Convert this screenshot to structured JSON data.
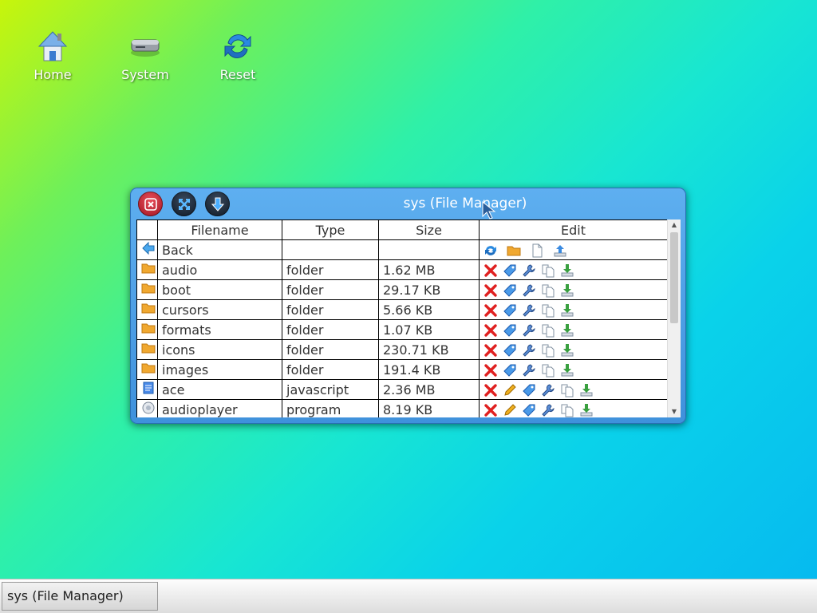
{
  "desktop": {
    "icons": [
      {
        "label": "Home",
        "icon": "home-icon"
      },
      {
        "label": "System",
        "icon": "drive-icon"
      },
      {
        "label": "Reset",
        "icon": "reset-icon"
      }
    ]
  },
  "window": {
    "title": "sys (File Manager)",
    "buttons": [
      "close-icon",
      "maximize-icon",
      "minimize-icon"
    ],
    "columns": [
      "Filename",
      "Type",
      "Size",
      "Edit"
    ],
    "back_label": "Back",
    "rows": [
      {
        "name": "audio",
        "type": "folder",
        "size": "1.62 MB"
      },
      {
        "name": "boot",
        "type": "folder",
        "size": "29.17 KB"
      },
      {
        "name": "cursors",
        "type": "folder",
        "size": "5.66 KB"
      },
      {
        "name": "formats",
        "type": "folder",
        "size": "1.07 KB"
      },
      {
        "name": "icons",
        "type": "folder",
        "size": "230.71 KB"
      },
      {
        "name": "images",
        "type": "folder",
        "size": "191.4 KB"
      },
      {
        "name": "ace",
        "type": "javascript",
        "size": "2.36 MB"
      },
      {
        "name": "audioplayer",
        "type": "program",
        "size": "8.19 KB"
      }
    ]
  },
  "taskbar": {
    "task_label": "sys (File Manager)"
  },
  "colors": {
    "window_blue": "#4a9fe6",
    "folder": "#f0a830",
    "delete": "#e02020",
    "download": "#3aa040"
  }
}
